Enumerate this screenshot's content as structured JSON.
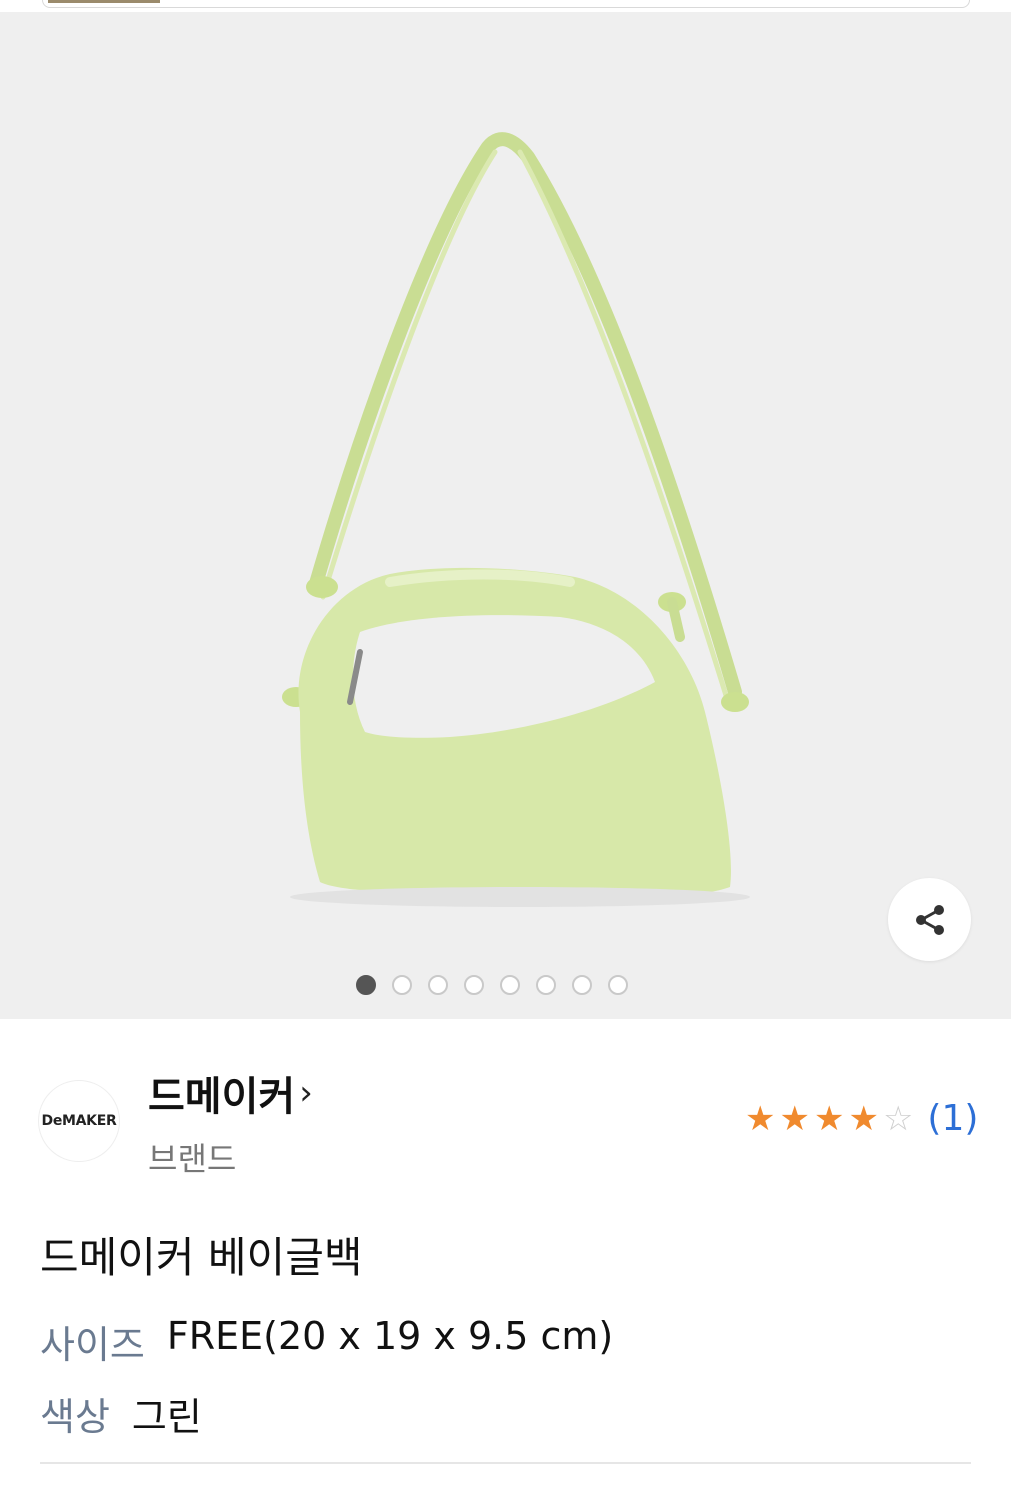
{
  "brand": {
    "logo_text": "DeMAKER",
    "name": "드메이커",
    "chevron": "›",
    "subtitle": "브랜드"
  },
  "rating": {
    "stars_filled": 4,
    "stars_total": 5,
    "review_count": "(1)"
  },
  "product": {
    "title": "드메이커 베이글백",
    "specs": [
      {
        "label": "사이즈",
        "value": "FREE(20 x 19 x 9.5 cm)"
      },
      {
        "label": "색상",
        "value": "그린"
      }
    ]
  },
  "gallery": {
    "page_count": 8,
    "current_page": 1
  },
  "colors": {
    "bag": "#d7e8a9",
    "background": "#efefef",
    "star": "#f08a2e",
    "link": "#2d6fd6"
  },
  "icons": {
    "share": "share-icon",
    "chevron": "chevron-right-icon"
  }
}
